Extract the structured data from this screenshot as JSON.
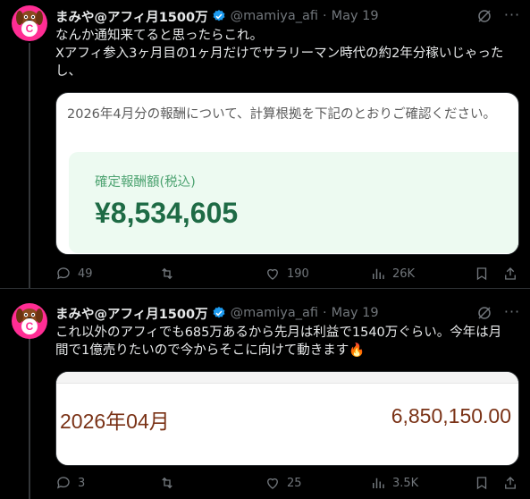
{
  "tweets": [
    {
      "author": {
        "display_name": "まみや@アフィ月1500万",
        "handle": "@mamiya_afi",
        "avatar_letter": "C"
      },
      "date": "May 19",
      "text_lines": [
        "なんか通知来てると思ったらこれ。",
        "Xアフィ参入3ヶ月目の1ヶ月だけでサラリーマン時代の約2年分稼いじゃった",
        "し、"
      ],
      "media": {
        "header": "2026年4月分の報酬について、計算根拠を下記のとおりご確認ください。",
        "label": "確定報酬額(税込)",
        "amount": "¥8,534,605"
      },
      "stats": {
        "replies": "49",
        "retweets": "",
        "likes": "190",
        "views": "26K"
      }
    },
    {
      "author": {
        "display_name": "まみや@アフィ月1500万",
        "handle": "@mamiya_afi",
        "avatar_letter": "C"
      },
      "date": "May 19",
      "text_lines": [
        "これ以外のアフィでも685万あるから先月は利益で1540万ぐらい。今年は月",
        "間で1億売りたいので今からそこに向けて動きます🔥"
      ],
      "media": {
        "month": "2026年04月",
        "amount": "6,850,150.00"
      },
      "stats": {
        "replies": "3",
        "retweets": "",
        "likes": "25",
        "views": "3.5K"
      }
    }
  ],
  "colors": {
    "accent": "#1d9bf0",
    "muted": "#71767b",
    "green": "#1e6b45",
    "brown": "#7a3216"
  }
}
